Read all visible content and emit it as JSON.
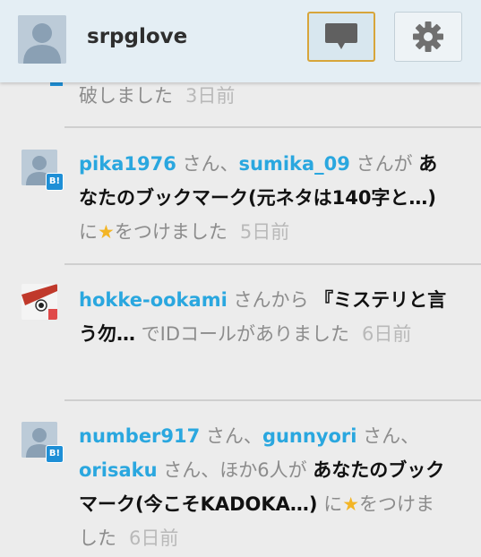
{
  "header": {
    "username": "srpglove",
    "notifications_icon": "speech-bubble-icon",
    "settings_icon": "gear-icon"
  },
  "badge_label": "B!",
  "notifications": [
    {
      "partial_text": "破しました",
      "time": "3日前"
    },
    {
      "user1": "pika1976",
      "sep1": " さん、",
      "user2": "sumika_09",
      "sep2": " さんが ",
      "target": "あなたのブックマーク(元ネタは140字と…)",
      "action_pre": " に",
      "star": "★",
      "action_post": "をつけました",
      "time": "5日前"
    },
    {
      "user1": "hokke-ookami",
      "sep1": " さんから ",
      "target": "『ミステリと言う勿…",
      "action": " でIDコールがありました",
      "time": "6日前"
    },
    {
      "user1": "number917",
      "sep1": " さん、",
      "user2": "gunnyori",
      "sep2": " さん、",
      "user3": "orisaku",
      "sep3": " さん、ほか6人が ",
      "target": "あなたのブックマーク(今こそKADOKA…)",
      "action_pre": " に",
      "star": "★",
      "action_post": "をつけました",
      "time": "6日前"
    }
  ],
  "colors": {
    "header_bg": "#e4eef4",
    "feed_bg": "#ececec",
    "link": "#2aa7df",
    "active_border": "#d7a53a",
    "star": "#f3b526",
    "badge": "#1e8fd6"
  }
}
